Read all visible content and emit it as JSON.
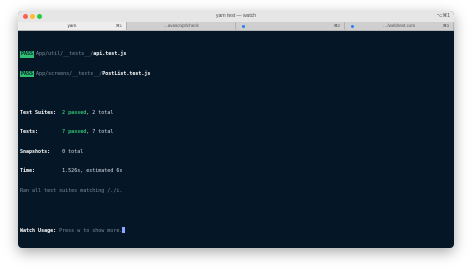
{
  "window": {
    "title": "yarn test — watch",
    "shortcut": "⌥⌘1"
  },
  "tabs": [
    {
      "label": "yarn",
      "shortcut": "⌘1",
      "active": true
    },
    {
      "label": "…avascript/check",
      "shortcut": "",
      "active": false
    },
    {
      "label": "",
      "shortcut": "⌘2",
      "active": false,
      "dot": true
    },
    {
      "label": "…/web/test.com",
      "shortcut": "⌘3",
      "active": false,
      "dot": true
    }
  ],
  "terminal": {
    "results": [
      {
        "badge": "PASS",
        "dir": "App/util/__tests__/",
        "file": "api.test.js"
      },
      {
        "badge": "PASS",
        "dir": "App/screens/__tests__/",
        "file": "PostList.test.js"
      }
    ],
    "summary": {
      "suites_label": "Test Suites:",
      "suites_passed": "2 passed",
      "suites_total": ", 2 total",
      "tests_label": "Tests:",
      "tests_passed": "7 passed",
      "tests_total": ", 7 total",
      "snapshots_label": "Snapshots:",
      "snapshots_value": "0 total",
      "time_label": "Time:",
      "time_value": "1.526s, estimated 6s",
      "ran_line": "Ran all test suites matching /./i."
    },
    "watch": {
      "label": "Watch Usage:",
      "text": " Press w to show more."
    }
  },
  "colors": {
    "terminal_bg": "#051727",
    "pass_badge": "#2fbf71",
    "cursor": "#8ba7ff"
  }
}
